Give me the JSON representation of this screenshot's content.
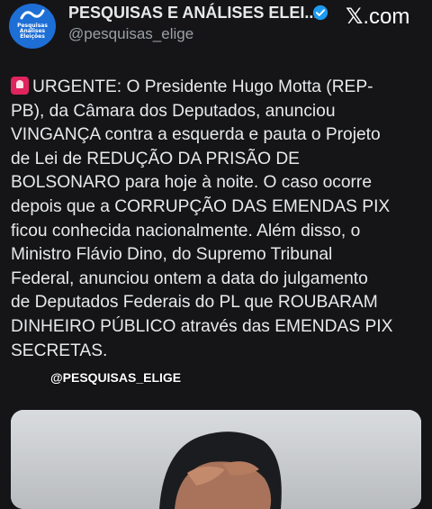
{
  "header": {
    "account_name": "PESQUISAS E ANÁLISES ELEI...",
    "handle": "@pesquisas_elige",
    "avatar_text": "Pesquisas Análises Eleições",
    "brand": "𝕏.com",
    "brand_x": "𝕏",
    "brand_suffix": ".com"
  },
  "tweet": {
    "emoji_icon": "rotating-light-icon",
    "text": "URGENTE: O Presidente Hugo Motta (REP-\nPB), da Câmara dos Deputados, anunciou\nVINGANÇA contra a esquerda e pauta o Projeto\nde Lei de REDUÇÃO DA PRISÃO DE\nBOLSONARO para hoje à noite. O caso ocorre\ndepois que a CORRUPÇÃO DAS EMENDAS PIX\nficou conhecida nacionalmente. Além disso, o\nMinistro Flávio Dino, do Supremo Tribunal\nFederal, anunciou ontem a data do julgamento\nde Deputados Federais do PL que ROUBARAM\nDINHEIRO PÚBLICO através das EMENDAS PIX\nSECRETAS."
  },
  "watermark": "@PESQUISAS_ELIGE",
  "colors": {
    "background": "#151518",
    "verified": "#1d9bf0",
    "avatar": "#1d6fd6"
  }
}
